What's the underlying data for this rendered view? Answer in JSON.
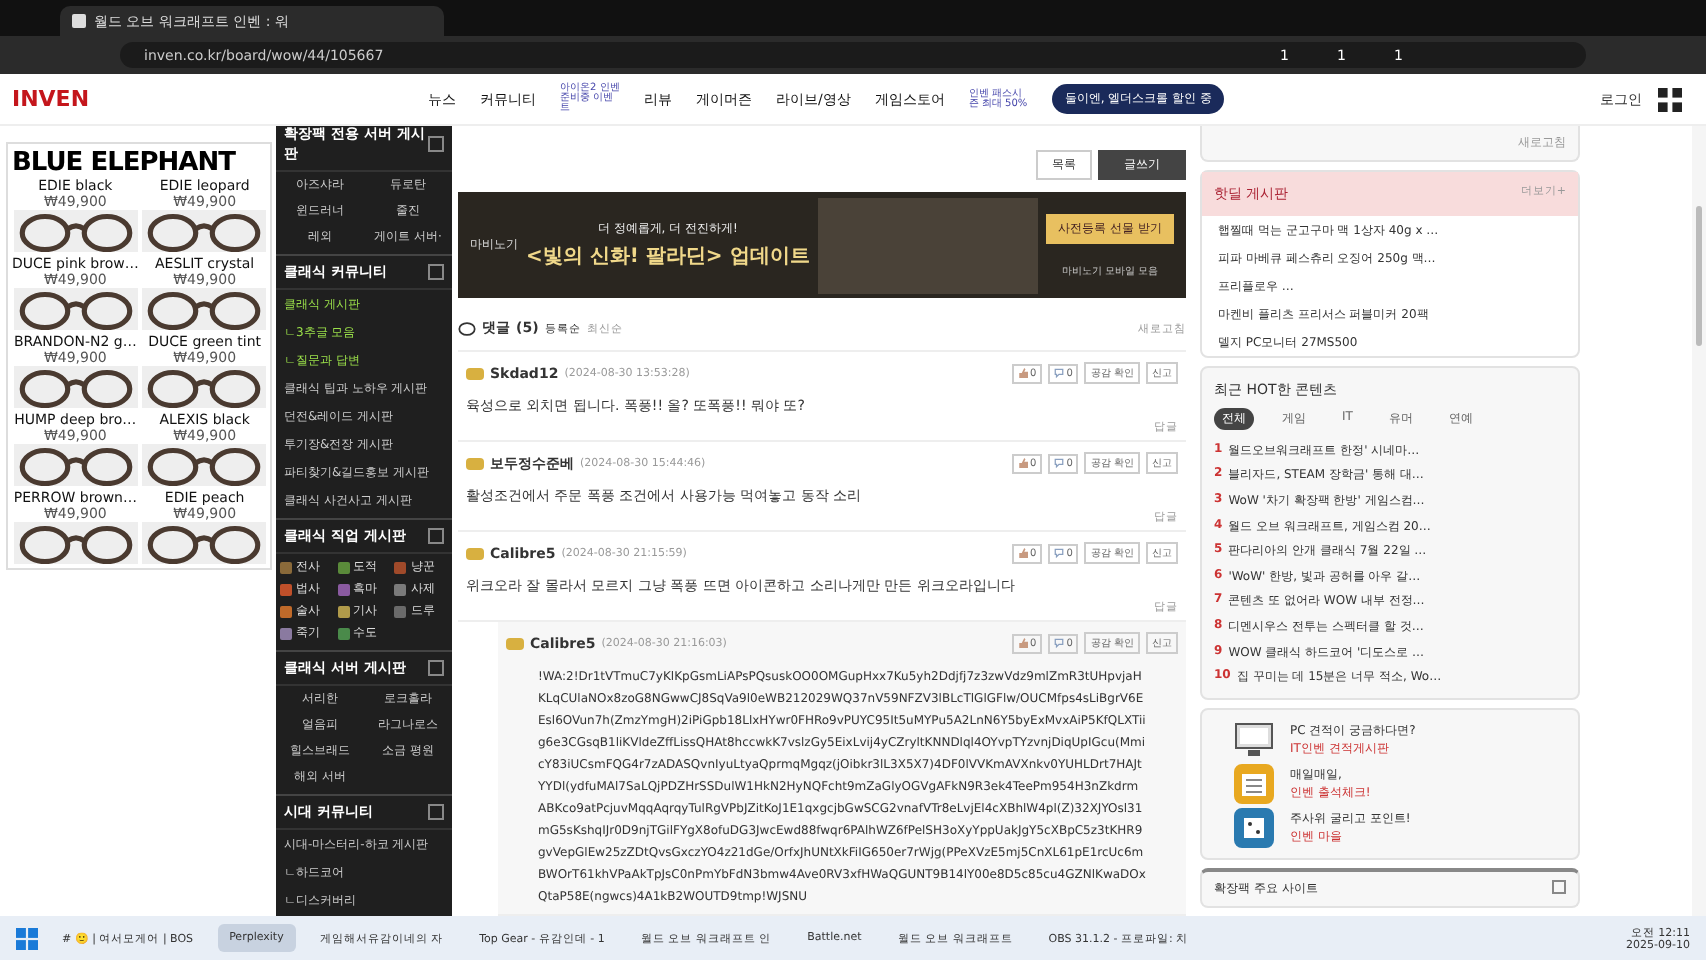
{
  "browser": {
    "tab_title": "월드 오브 워크래프트 인벤 : 워",
    "url": "inven.co.kr/board/wow/44/105667",
    "badges": [
      "1",
      "1",
      "1"
    ]
  },
  "nav": {
    "logo": "INVEN",
    "items": [
      {
        "label": "뉴스"
      },
      {
        "label": "커뮤니티",
        "note": "아이온2 인벤 준비중 이벤트"
      },
      {
        "label": "리뷰"
      },
      {
        "label": "게이머즌"
      },
      {
        "label": "라이브/영상"
      },
      {
        "label": "게임스토어",
        "note": "인벤 패스시즌 최대 50%"
      }
    ],
    "promo": "둘이엔, 엘더스크롤 할인 중",
    "login": "로그인"
  },
  "ad": {
    "brand": "BLUE ELEPHANT",
    "products": [
      {
        "name": "EDIE black",
        "price": "₩49,900"
      },
      {
        "name": "EDIE leopard",
        "price": "₩49,900"
      },
      {
        "name": "DUCE pink brow…",
        "price": "₩49,900"
      },
      {
        "name": "AESLIT crystal",
        "price": "₩49,900"
      },
      {
        "name": "BRANDON-N2 g…",
        "price": "₩49,900"
      },
      {
        "name": "DUCE green tint",
        "price": "₩49,900"
      },
      {
        "name": "HUMP deep bro…",
        "price": "₩49,900"
      },
      {
        "name": "ALEXIS black",
        "price": "₩49,900"
      },
      {
        "name": "PERROW brown…",
        "price": "₩49,900"
      },
      {
        "name": "EDIE peach",
        "price": "₩49,900"
      }
    ]
  },
  "sidebar": {
    "sections": [
      {
        "title": "확장팩 전용 서버 게시판",
        "kind": "grid",
        "items": [
          {
            "label": "아즈샤라",
            "selected": false
          },
          {
            "label": "듀로탄",
            "selected": false
          },
          {
            "label": "윈드러너",
            "selected": false
          },
          {
            "label": "줄진",
            "selected": false
          },
          {
            "label": "레외",
            "selected": false
          },
          {
            "label": "게이트 서버·",
            "selected": false
          }
        ]
      },
      {
        "title": "클래식 커뮤니티",
        "kind": "list",
        "items": [
          {
            "label": "클래식 게시판",
            "selected": true
          },
          {
            "label": "ㄴ3추글 모음",
            "selected": true
          },
          {
            "label": "ㄴ질문과 답변",
            "selected": true
          },
          {
            "label": "클래식 팁과 노하우 게시판",
            "selected": false
          },
          {
            "label": "던전&레이드 게시판",
            "selected": false
          },
          {
            "label": "투기장&전장 게시판",
            "selected": false
          },
          {
            "label": "파티찾기&길드홍보 게시판",
            "selected": false
          },
          {
            "label": "클래식 사건사고 게시판",
            "selected": false
          }
        ]
      },
      {
        "title": "클래식 직업 게시판",
        "kind": "classes",
        "items": [
          {
            "label": "전사",
            "color": "#8a6a3a"
          },
          {
            "label": "도적",
            "color": "#5a8a3a"
          },
          {
            "label": "냥꾼",
            "color": "#a04a2a"
          },
          {
            "label": "법사",
            "color": "#c0502a"
          },
          {
            "label": "흑마",
            "color": "#8a5aa0"
          },
          {
            "label": "사제",
            "color": "#7a7a7a"
          },
          {
            "label": "술사",
            "color": "#c06a2a"
          },
          {
            "label": "기사",
            "color": "#b09a4a"
          },
          {
            "label": "드루",
            "color": "#6a6a6a"
          },
          {
            "label": "죽기",
            "color": "#8a7aa0"
          },
          {
            "label": "수도",
            "color": "#4a8a4a"
          }
        ]
      },
      {
        "title": "클래식 서버 게시판",
        "kind": "grid",
        "items": [
          {
            "label": "서리한",
            "selected": false
          },
          {
            "label": "로크홀라",
            "selected": false
          },
          {
            "label": "얼음피",
            "selected": false
          },
          {
            "label": "라그나로스",
            "selected": false
          },
          {
            "label": "힐스브래드",
            "selected": false
          },
          {
            "label": "소금 평원",
            "selected": false
          },
          {
            "label": "해외 서버",
            "selected": false
          }
        ]
      },
      {
        "title": "시대 커뮤니티",
        "kind": "list",
        "items": [
          {
            "label": "시대-마스터리-하코 게시판",
            "selected": false
          },
          {
            "label": "ㄴ하드코어",
            "selected": false
          },
          {
            "label": "ㄴ디스커버리",
            "selected": false
          }
        ]
      }
    ]
  },
  "board": {
    "buttons": [
      {
        "label": "목록",
        "kind": "plain"
      },
      {
        "label": "글쓰기",
        "kind": "primary"
      }
    ],
    "banner": {
      "tagline": "더 정예롭게, 더 전진하게!",
      "headline": "<빛의 신화! 팔라딘> 업데이트",
      "cta": "사전등록 선물 받기",
      "brand": "마비노기",
      "note": "마비노기 모바일 모음"
    },
    "comments_header": {
      "title": "댓글",
      "count": "(5)",
      "sorts": [
        {
          "label": "등록순",
          "selected": true
        },
        {
          "label": "최신순",
          "selected": false
        }
      ],
      "refresh": "새로고침"
    },
    "comments": [
      {
        "user": "Skdad12",
        "date": "(2024-08-30 13:53:28)",
        "likes": "0",
        "dislikes": "0",
        "check": "공감 확인",
        "report": "신고",
        "body": "육성으로 외치면 됩니다. 폭풍!! 올? 또폭풍!! 뭐야 또?",
        "reply": "답글",
        "kind": "comment"
      },
      {
        "user": "보두정수준베",
        "date": "(2024-08-30 15:44:46)",
        "likes": "0",
        "dislikes": "0",
        "check": "공감 확인",
        "report": "신고",
        "body": "활성조건에서 주문 폭풍 조건에서 사용가능 먹여놓고 동작 소리",
        "reply": "답글",
        "kind": "comment"
      },
      {
        "user": "Calibre5",
        "date": "(2024-08-30 21:15:59)",
        "likes": "0",
        "dislikes": "0",
        "check": "공감 확인",
        "report": "신고",
        "body": "위크오라 잘 몰라서 모르지 그냥 폭풍 뜨면 아이콘하고 소리나게만 만든 위크오라입니다",
        "reply": "답글",
        "kind": "comment"
      },
      {
        "user": "Calibre5",
        "date": "(2024-08-30 21:16:03)",
        "likes": "0",
        "dislikes": "0",
        "check": "공감 확인",
        "report": "신고",
        "body": "!WA:2!Dr1tVTmuC7yKlKpGsmLiAPsPQsuskOO0OMGupHxx7Ku5yh2Ddjfj7z3zwVdz9mlZmR3tUHpvjaHKLqCUlaNOx8zoG8NGwwCJ8SqVa9l0eWB212029WQ37nV59NFZV3lBLcTlGlGFlw/OUCMfps4sLiBgrV6EEsl6OVun7h(ZmzYmgH)2iPiGpb18LlxHYwr0FHRo9vPUYC95It5uMYPu5A2LnN6Y5byExMvxAiP5KfQLXTiig6e3CGsqB1liKVldeZffLissQHAt8hccwkK7vslzGy5EixLvij4yCZryltKNNDlql4OYvpTYzvnjDiqUpIGcu(MmicY83iUCsmFQG4r7zADASQvnIyuLtyaQprmqMgqz(jOibkr3lL3X5X7)4DF0lVVKmAVXnkv0YUHLDrt7HAJtYYDl(ydfuMAl7SaLQjPDZHrSSDulW1HkN2HyNQFcht9mZaGlyOGVgAFkN9R3ek4TeePm954H3nZkdrmABKco9atPcjuvMqqAqrqyTulRgVPbJZitKoJ1E1qxgcjbGwSCG2vnafVTr8eLvjEl4cXBhlW4pl(Z)32XJYOsl31mG5sKshqIJr0D9njTGilFYgX8ofuDG3JwcEwd88fwqr6PAlhWZ6fPelSH3oXyYppUakJgY5cXBpC5z3tKHR9gvVepGlEw25zZDtQvsGxczYO4z21dGe/OrfxJhUNtXkFiIG650er7rWjg(PPeXVzE5mj5CnXL61pE1rcUc6mBWOrT61khVPaAkTpJsC0nPmYbFdN3bmw4Ave0RV3xfHWaQGUNT9B14lY00e8D5c85cu4GZNlKwaDOxQtaP58E(ngwcs)4A1kB2WOUTD9tmp!WJSNU",
        "kind": "code"
      }
    ]
  },
  "right": {
    "refresh": "새로고침",
    "hotdeal": {
      "title": "핫딜 게시판",
      "more": "더보기+",
      "items": [
        "햅찔때 먹는 군고구마 맥 1상자 40g x …",
        "피파 마베큐 페스츄리 오징어 250g 맥…",
        "프리플로우 …",
        "마켄비 플리츠 프리서스 퍼블미커 20팩",
        "델지 PC모니터 27MS500"
      ]
    },
    "hot": {
      "title": "최근 HOT한 콘텐츠",
      "tabs": [
        {
          "label": "전체",
          "selected": true
        },
        {
          "label": "게임",
          "selected": false
        },
        {
          "label": "IT",
          "selected": false
        },
        {
          "label": "유머",
          "selected": false
        },
        {
          "label": "연예",
          "selected": false
        }
      ],
      "items": [
        {
          "rank": "1",
          "title": "월드오브워크래프트 한정' 시네마…"
        },
        {
          "rank": "2",
          "title": "블리자드, STEAM 장학금' 통해 대…"
        },
        {
          "rank": "3",
          "title": "WoW '차기 확장팩 한방' 게임스컴…"
        },
        {
          "rank": "4",
          "title": "월드 오브 워크래프트, 게임스컴 20…"
        },
        {
          "rank": "5",
          "title": "판다리아의 안개 클래식 7월 22일 …"
        },
        {
          "rank": "6",
          "title": "'WoW' 한방, 빛과 공허를 아우 갈…"
        },
        {
          "rank": "7",
          "title": "콘텐츠 또 없어라 WOW 내부 전정…"
        },
        {
          "rank": "8",
          "title": "디멘시우스 전투는 스펙터클 할 것…"
        },
        {
          "rank": "9",
          "title": "WOW 클래식 하드코어 '디도스로 …"
        },
        {
          "rank": "10",
          "title": "집 꾸미는 데 15분은 너무 적소, Wo…"
        }
      ]
    },
    "promos": [
      {
        "kind": "monitor",
        "line1": "PC 견적이 궁금하다면?",
        "line2": "IT인벤 견적게시판"
      },
      {
        "kind": "calendar",
        "line1": "매일매일,",
        "line2": "인벤 출석체크!"
      },
      {
        "kind": "dice",
        "line1": "주사위 굴리고 포인트!",
        "line2": "인벤 마을"
      }
    ],
    "sites": "확장팩 주요 사이트"
  },
  "taskbar": {
    "items": [
      {
        "label": "# 🙂 | 여서모게어 | BOS",
        "selected": false
      },
      {
        "label": "Perplexity",
        "selected": true
      },
      {
        "label": "게임해서유감이네의 자",
        "selected": false
      },
      {
        "label": "Top Gear - 유감인데 - 1",
        "selected": false
      },
      {
        "label": "월드 오브 워크래프트 인",
        "selected": false
      },
      {
        "label": "Battle.net",
        "selected": false
      },
      {
        "label": "월드 오브 워크래프트",
        "selected": false
      },
      {
        "label": "OBS 31.1.2 - 프로파일: 치",
        "selected": false
      }
    ],
    "time": "오전 12:11",
    "date": "2025-09-10"
  }
}
